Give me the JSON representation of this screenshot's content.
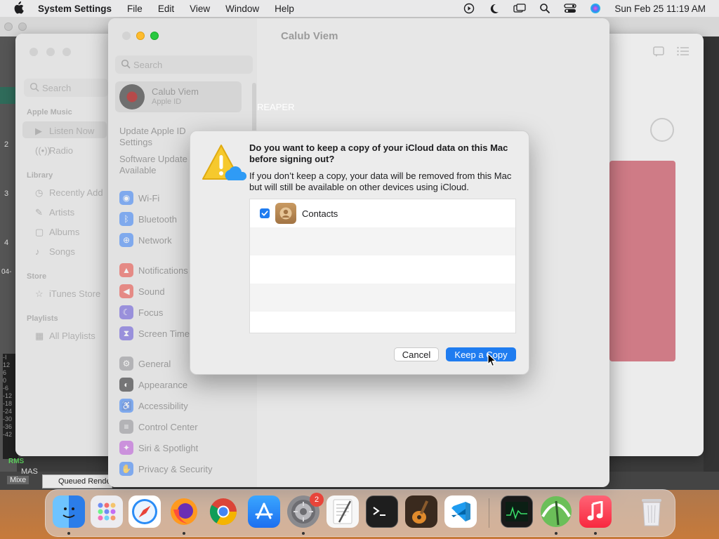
{
  "menubar": {
    "app_name": "System Settings",
    "menus": [
      "File",
      "Edit",
      "View",
      "Window",
      "Help"
    ],
    "clock": "Sun Feb 25  11:19 AM",
    "status_icons": [
      "play-circle-icon",
      "moon-icon",
      "window-icon",
      "search-icon",
      "control-center-icon",
      "siri-icon"
    ]
  },
  "reaper": {
    "track_numbers": [
      "2",
      "3",
      "4"
    ],
    "time_label": "04-",
    "meter_labels": [
      "-I",
      "12",
      "6",
      "0",
      "-6",
      "-12",
      "-18",
      "-24",
      "-30",
      "-36",
      "-42"
    ],
    "rms": "RMS",
    "master": "MAS",
    "mixer_tab": "Mixe",
    "queued": "Queued Rende"
  },
  "music": {
    "search_placeholder": "Search",
    "sections": {
      "apple_music": "Apple Music",
      "library": "Library",
      "store": "Store",
      "playlists": "Playlists"
    },
    "apple_music_items": [
      "Listen Now",
      "Radio"
    ],
    "library_items": [
      "Recently Add",
      "Artists",
      "Albums",
      "Songs"
    ],
    "store_items": [
      "iTunes Store"
    ],
    "playlist_items": [
      "All Playlists"
    ]
  },
  "settings": {
    "window_title": "Calub Viem",
    "search_placeholder": "Search",
    "account_name": "Calub Viem",
    "account_sub": "Apple ID",
    "update_apple_id": "Update Apple ID Settings",
    "software_update": "Software Update Available",
    "content_label": "REAPER",
    "items": [
      {
        "label": "Wi-Fi",
        "icon": "wifi-icon",
        "color": "#2f7cf6"
      },
      {
        "label": "Bluetooth",
        "icon": "bluetooth-icon",
        "color": "#2f7cf6"
      },
      {
        "label": "Network",
        "icon": "globe-icon",
        "color": "#2f7cf6"
      },
      {
        "label": "Notifications",
        "icon": "bell-icon",
        "color": "#e8443a"
      },
      {
        "label": "Sound",
        "icon": "speaker-icon",
        "color": "#e8443a"
      },
      {
        "label": "Focus",
        "icon": "moon-icon",
        "color": "#5e4ed6"
      },
      {
        "label": "Screen Time",
        "icon": "hourglass-icon",
        "color": "#5e4ed6"
      },
      {
        "label": "General",
        "icon": "gear-icon",
        "color": "#8e8e93"
      },
      {
        "label": "Appearance",
        "icon": "appearance-icon",
        "color": "#1d1d1f"
      },
      {
        "label": "Accessibility",
        "icon": "accessibility-icon",
        "color": "#2f7cf6"
      },
      {
        "label": "Control Center",
        "icon": "control-center-icon",
        "color": "#8e8e93"
      },
      {
        "label": "Siri & Spotlight",
        "icon": "siri-icon",
        "color": "#b94fd8"
      },
      {
        "label": "Privacy & Security",
        "icon": "hand-icon",
        "color": "#2f7cf6"
      }
    ]
  },
  "dialog": {
    "title": "Do you want to keep a copy of your iCloud data on this Mac before signing out?",
    "message": "If you don’t keep a copy, your data will be removed from this Mac but will still be available on other devices using iCloud.",
    "items": [
      {
        "label": "Contacts",
        "checked": true
      }
    ],
    "cancel_label": "Cancel",
    "keep_label": "Keep a Copy"
  },
  "dock": {
    "apps": [
      {
        "name": "finder-icon",
        "color": "#3b8ef0"
      },
      {
        "name": "launchpad-icon",
        "color": "#e9e9ee"
      },
      {
        "name": "safari-icon",
        "color": "#1f8ef0"
      },
      {
        "name": "firefox-icon",
        "color": "#ff7a18"
      },
      {
        "name": "chrome-icon",
        "color": "#f1f1f1"
      },
      {
        "name": "app-store-icon",
        "color": "#2a8cf6"
      },
      {
        "name": "system-settings-icon",
        "color": "#8a8a8e"
      },
      {
        "name": "textedit-icon",
        "color": "#f5f5f5"
      },
      {
        "name": "terminal-icon",
        "color": "#1e1e1e"
      },
      {
        "name": "garageband-icon",
        "color": "#e08a2c"
      },
      {
        "name": "vscode-icon",
        "color": "#ffffff"
      },
      {
        "name": "activity-monitor-icon",
        "color": "#1a1a1a"
      },
      {
        "name": "reaper-icon",
        "color": "#6bbf59"
      },
      {
        "name": "music-icon",
        "color": "#fb3c4e"
      },
      {
        "name": "trash-icon",
        "color": "#e6e6e8"
      }
    ],
    "settings_badge": "2"
  }
}
